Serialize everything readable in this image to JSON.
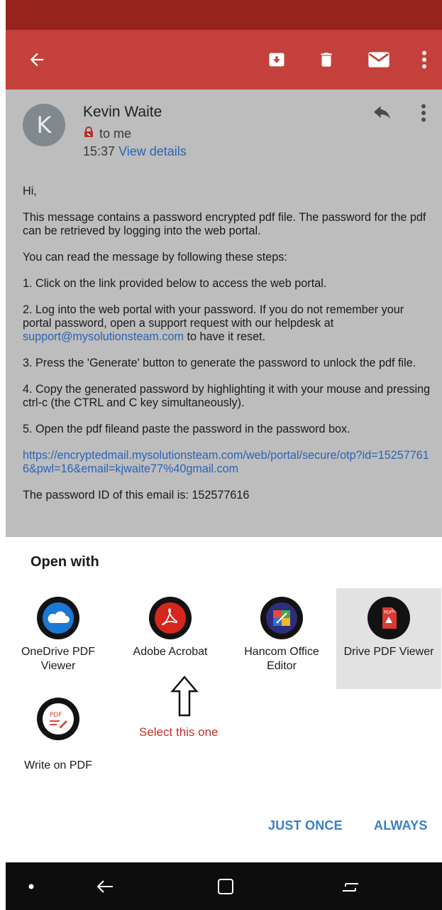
{
  "toolbar": {
    "icons": [
      "back-arrow-icon",
      "archive-icon",
      "delete-icon",
      "mail-icon",
      "more-vert-icon"
    ]
  },
  "email": {
    "avatar_letter": "K",
    "sender": "Kevin Waite",
    "recipient": "to me",
    "time": "15:37",
    "view_details": "View details",
    "greeting": "Hi,",
    "paragraph_1": "This message contains a password encrypted pdf file. The password for the pdf can be retrieved by logging into the web portal.",
    "paragraph_2": "You can read the message by following these steps:",
    "step_1": "1. Click on the link provided below to access the web portal.",
    "step_2_before": "2. Log into the web portal with your password. If you do not remember your portal password, open a support request with our helpdesk at ",
    "step_2_email": "support@mysolutionsteam.com",
    "step_2_after": " to have it reset.",
    "step_3": "3. Press the 'Generate' button to generate the password to unlock the pdf file.",
    "step_4": "4. Copy the generated password by highlighting it with your mouse and pressing ctrl-c (the CTRL and C key simultaneously).",
    "step_5": "5. Open the pdf fileand paste the password in the password box.",
    "portal_link": "https://encryptedmail.mysolutionsteam.com/web/portal/secure/otp?id=152577616&pwl=16&email=kjwaite77%40gmail.com",
    "password_id": "The password ID of this email is: 152577616"
  },
  "open_with": {
    "title": "Open with",
    "apps": [
      {
        "label": "OneDrive PDF Viewer",
        "icon": "onedrive-icon"
      },
      {
        "label": "Adobe Acrobat",
        "icon": "adobe-acrobat-icon"
      },
      {
        "label": "Hancom Office Editor",
        "icon": "hancom-office-icon"
      },
      {
        "label": "Drive PDF Viewer",
        "icon": "drive-pdf-icon"
      },
      {
        "label": "Write on PDF",
        "icon": "write-on-pdf-icon"
      }
    ],
    "annotation": "Select this one",
    "just_once": "JUST ONCE",
    "always": "ALWAYS"
  },
  "nav_bar": {
    "icons": [
      "dot-icon",
      "back-icon",
      "home-icon",
      "recents-icon"
    ]
  },
  "colors": {
    "status_bar": "#97241c",
    "toolbar": "#c4403a",
    "link": "#2b63b8",
    "action": "#3a7fc6",
    "annotation": "#c0302b"
  }
}
